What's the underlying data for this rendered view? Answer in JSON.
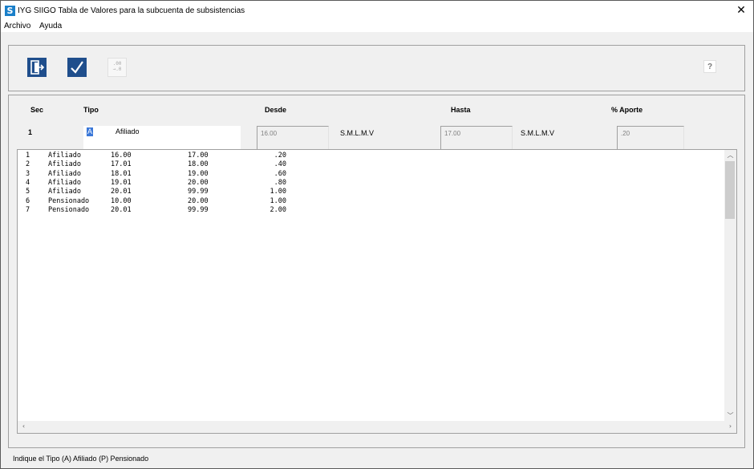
{
  "window": {
    "title": "IYG SIIGO Tabla de Valores para la subcuenta de subsistencias",
    "app_icon_letter": "S",
    "close_glyph": "✕"
  },
  "menu": {
    "items": [
      "Archivo",
      "Ayuda"
    ]
  },
  "toolbar": {
    "buttons": [
      {
        "icon": "exit-icon",
        "enabled": true
      },
      {
        "icon": "checkmark-icon",
        "enabled": true
      },
      {
        "icon": "decimal-shift-icon",
        "enabled": false,
        "glyph_top": ".00",
        "glyph_bottom": "→.0"
      }
    ],
    "help_label": "?"
  },
  "form": {
    "headers": {
      "sec": "Sec",
      "tipo": "Tipo",
      "desde": "Desde",
      "hasta": "Hasta",
      "aporte": "% Aporte"
    },
    "current": {
      "sec": "1",
      "tipo_code": "A",
      "tipo_text": "Afiliado",
      "desde": "16.00",
      "desde_unit": "S.M.L.M.V",
      "hasta": "17.00",
      "hasta_unit": "S.M.L.M.V",
      "aporte": ".20"
    }
  },
  "grid": {
    "rows": [
      {
        "sec": "1",
        "tipo": "Afiliado",
        "desde": "16.00",
        "hasta": "17.00",
        "aporte": ".20"
      },
      {
        "sec": "2",
        "tipo": "Afiliado",
        "desde": "17.01",
        "hasta": "18.00",
        "aporte": ".40"
      },
      {
        "sec": "3",
        "tipo": "Afiliado",
        "desde": "18.01",
        "hasta": "19.00",
        "aporte": ".60"
      },
      {
        "sec": "4",
        "tipo": "Afiliado",
        "desde": "19.01",
        "hasta": "20.00",
        "aporte": ".80"
      },
      {
        "sec": "5",
        "tipo": "Afiliado",
        "desde": "20.01",
        "hasta": "99.99",
        "aporte": "1.00"
      },
      {
        "sec": "6",
        "tipo": "Pensionado",
        "desde": "10.00",
        "hasta": "20.00",
        "aporte": "1.00"
      },
      {
        "sec": "7",
        "tipo": "Pensionado",
        "desde": "20.01",
        "hasta": "99.99",
        "aporte": "2.00"
      }
    ]
  },
  "status": {
    "text": "Indique el Tipo (A) Afiliado (P) Pensionado"
  }
}
